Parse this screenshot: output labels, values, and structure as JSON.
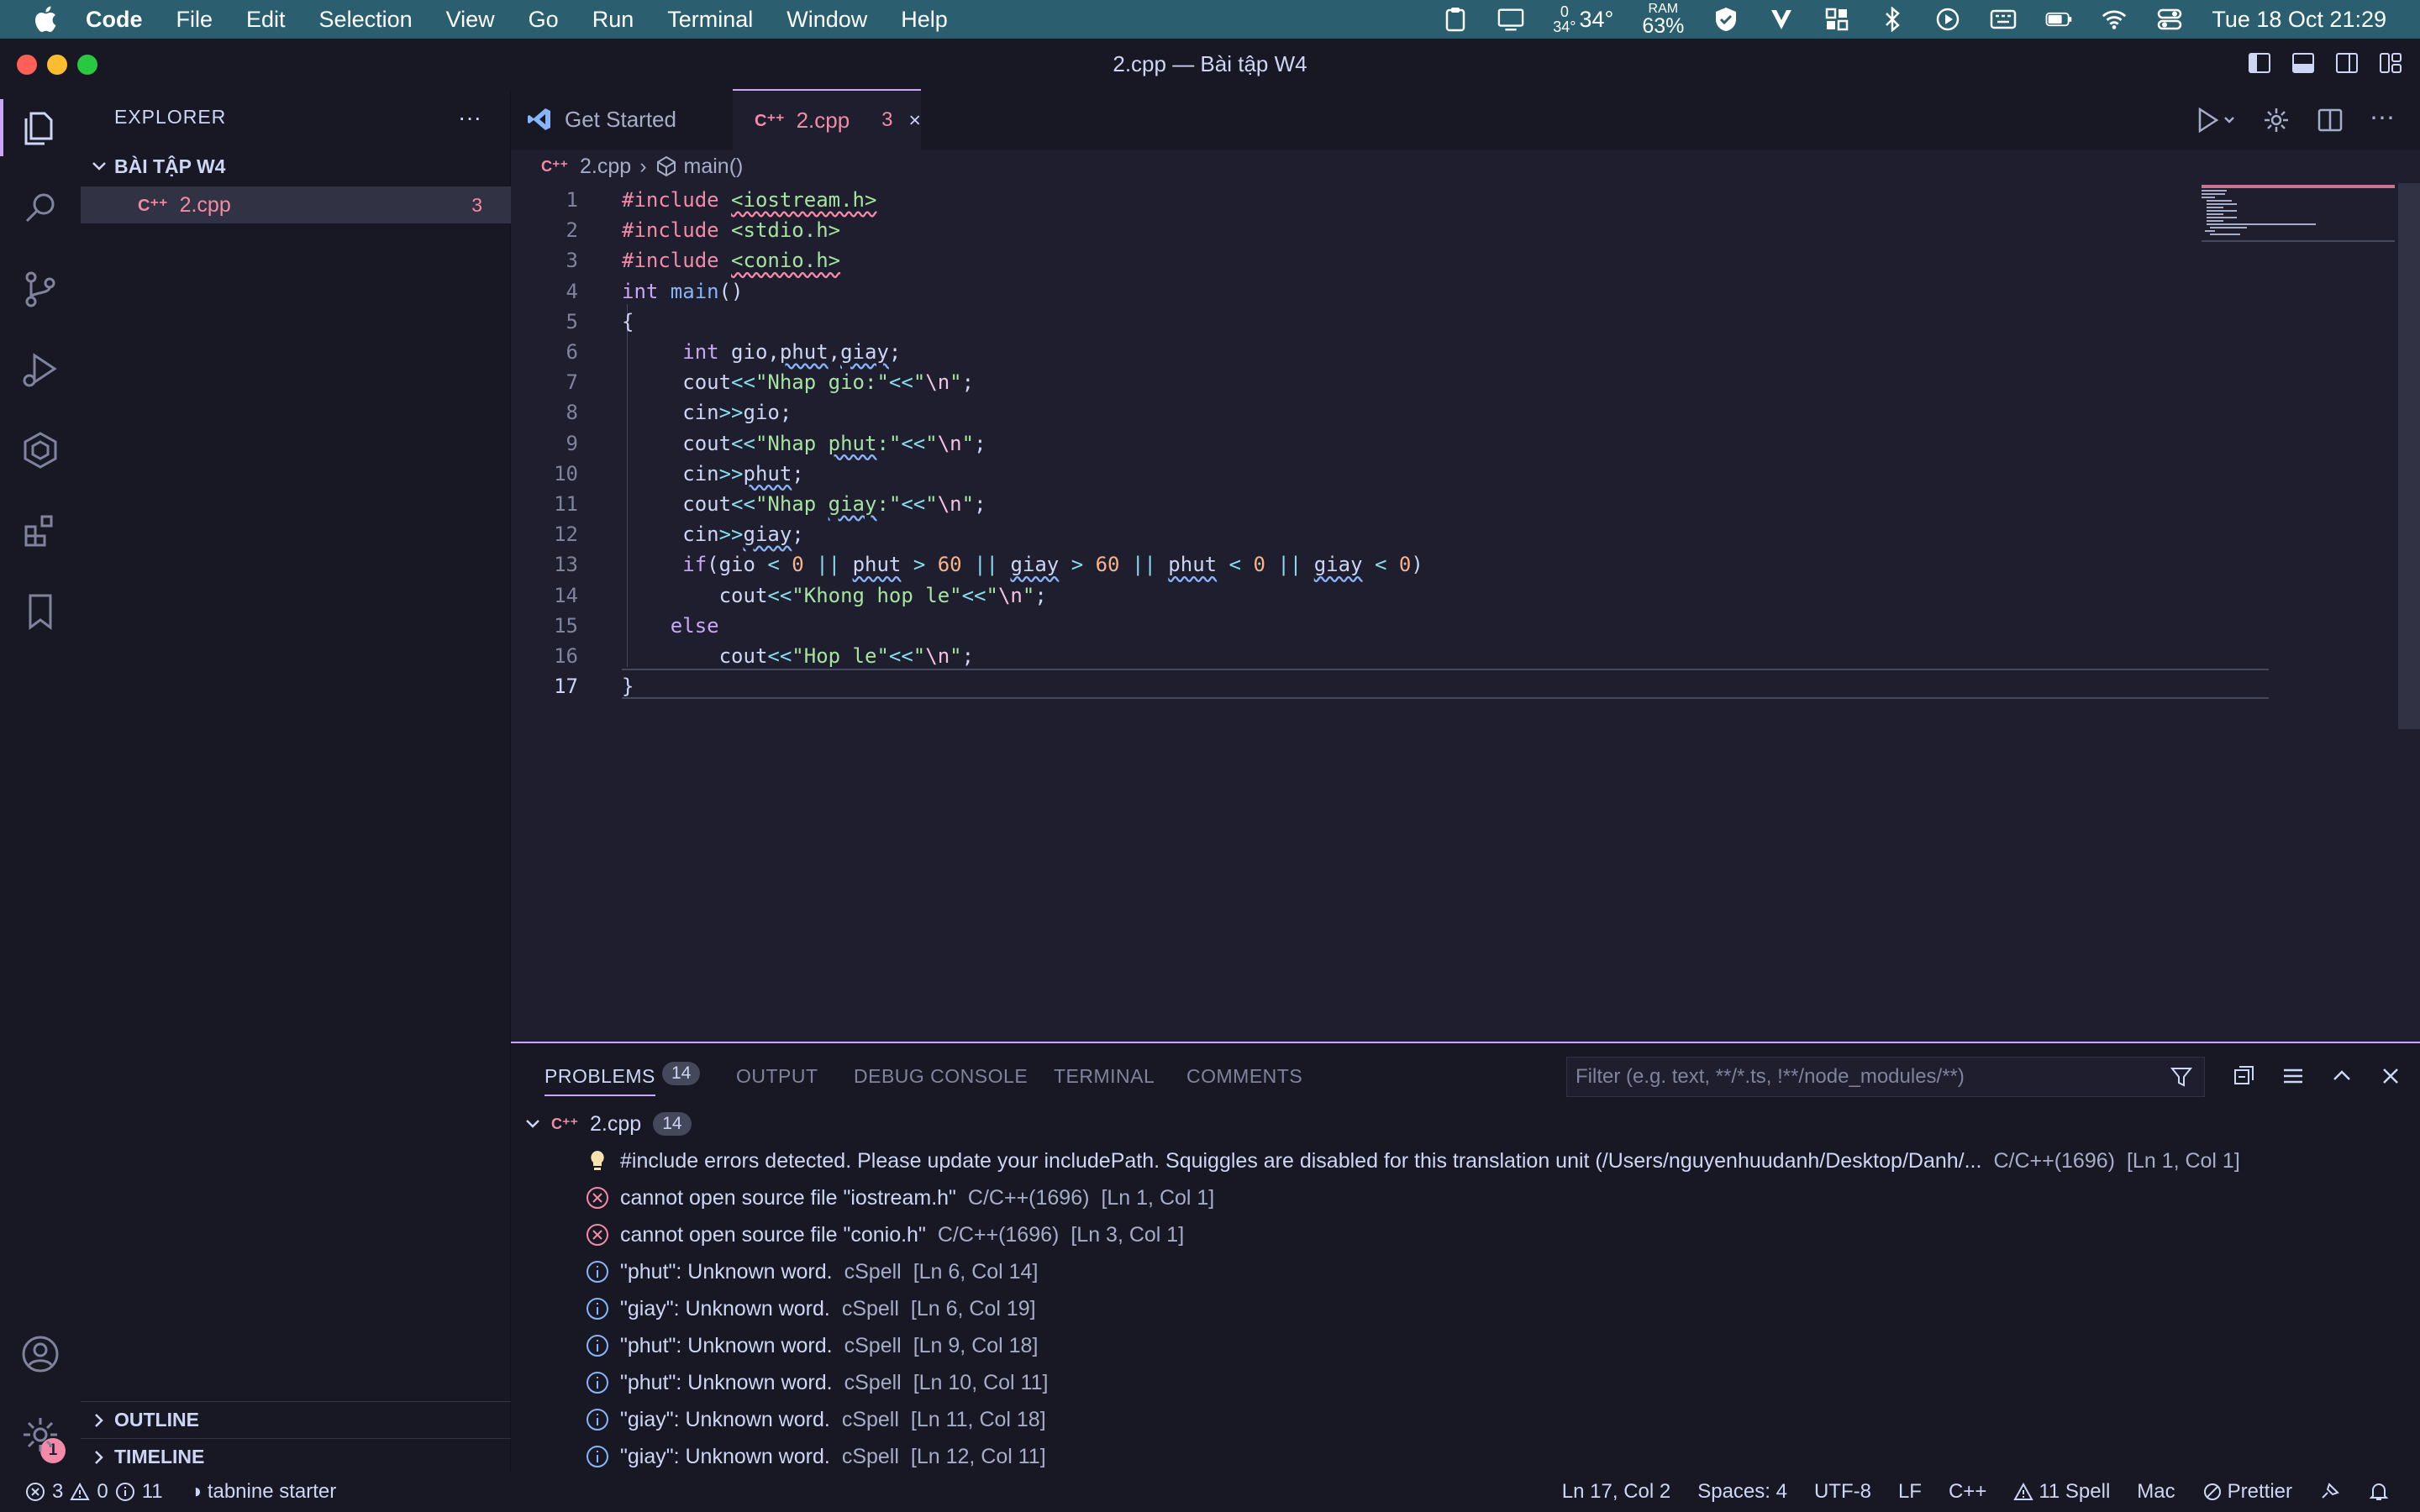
{
  "menubar": {
    "app": "Code",
    "items": [
      "File",
      "Edit",
      "Selection",
      "View",
      "Go",
      "Run",
      "Terminal",
      "Window",
      "Help"
    ],
    "weather_small": "34°",
    "weather_top": "0",
    "weather": "34°",
    "ram_label": "RAM",
    "ram": "63%",
    "datetime": "Tue 18 Oct  21:29"
  },
  "window": {
    "title": "2.cpp — Bài tập W4"
  },
  "sidebar": {
    "header": "EXPLORER",
    "folder": "BÀI TẬP W4",
    "file": {
      "name": "2.cpp",
      "problems": "3"
    },
    "outline": "OUTLINE",
    "timeline": "TIMELINE"
  },
  "activity": {
    "account_badge": "1"
  },
  "tabs": [
    {
      "label": "Get Started"
    },
    {
      "label": "2.cpp",
      "problems": "3"
    }
  ],
  "breadcrumb": {
    "file": "2.cpp",
    "symbol": "main()"
  },
  "code": {
    "lines": [
      [
        [
          "pp",
          "#include "
        ],
        [
          "squig-r str",
          "<iostream.h>"
        ]
      ],
      [
        [
          "pp",
          "#include "
        ],
        [
          "str",
          "<stdio.h>"
        ]
      ],
      [
        [
          "pp",
          "#include "
        ],
        [
          "squig-r str",
          "<conio.h>"
        ]
      ],
      [
        [
          "kw",
          "int "
        ],
        [
          "fn",
          "main"
        ],
        [
          "tx",
          "()"
        ]
      ],
      [
        [
          "tx",
          "{"
        ]
      ],
      [
        [
          "tx",
          "     "
        ],
        [
          "kw",
          "int "
        ],
        [
          "tx",
          "gio,"
        ],
        [
          "squig-b tx",
          "phut"
        ],
        [
          "tx",
          ","
        ],
        [
          "squig-b tx",
          "giay"
        ],
        [
          "tx",
          ";"
        ]
      ],
      [
        [
          "tx",
          "     cout"
        ],
        [
          "op",
          "<<"
        ],
        [
          "str",
          "\"Nhap gio:\""
        ],
        [
          "op",
          "<<"
        ],
        [
          "str",
          "\""
        ],
        [
          "esc",
          "\\n"
        ],
        [
          "str",
          "\""
        ],
        [
          "tx",
          ";"
        ]
      ],
      [
        [
          "tx",
          "     cin"
        ],
        [
          "op",
          ">>"
        ],
        [
          "tx",
          "gio;"
        ]
      ],
      [
        [
          "tx",
          "     cout"
        ],
        [
          "op",
          "<<"
        ],
        [
          "str",
          "\"Nhap "
        ],
        [
          "squig-b str",
          "phut"
        ],
        [
          "str",
          ":\""
        ],
        [
          "op",
          "<<"
        ],
        [
          "str",
          "\""
        ],
        [
          "esc",
          "\\n"
        ],
        [
          "str",
          "\""
        ],
        [
          "tx",
          ";"
        ]
      ],
      [
        [
          "tx",
          "     cin"
        ],
        [
          "op",
          ">>"
        ],
        [
          "squig-b tx",
          "phut"
        ],
        [
          "tx",
          ";"
        ]
      ],
      [
        [
          "tx",
          "     cout"
        ],
        [
          "op",
          "<<"
        ],
        [
          "str",
          "\"Nhap "
        ],
        [
          "squig-b str",
          "giay"
        ],
        [
          "str",
          ":\""
        ],
        [
          "op",
          "<<"
        ],
        [
          "str",
          "\""
        ],
        [
          "esc",
          "\\n"
        ],
        [
          "str",
          "\""
        ],
        [
          "tx",
          ";"
        ]
      ],
      [
        [
          "tx",
          "     cin"
        ],
        [
          "op",
          ">>"
        ],
        [
          "squig-b tx",
          "giay"
        ],
        [
          "tx",
          ";"
        ]
      ],
      [
        [
          "tx",
          "     "
        ],
        [
          "kw",
          "if"
        ],
        [
          "tx",
          "(gio "
        ],
        [
          "op",
          "<"
        ],
        [
          "num",
          " 0 "
        ],
        [
          "op",
          "||"
        ],
        [
          "tx",
          " "
        ],
        [
          "squig-b tx",
          "phut"
        ],
        [
          "tx",
          " "
        ],
        [
          "op",
          ">"
        ],
        [
          "num",
          " 60 "
        ],
        [
          "op",
          "||"
        ],
        [
          "tx",
          " "
        ],
        [
          "squig-b tx",
          "giay"
        ],
        [
          "tx",
          " "
        ],
        [
          "op",
          ">"
        ],
        [
          "num",
          " 60 "
        ],
        [
          "op",
          "||"
        ],
        [
          "tx",
          " "
        ],
        [
          "squig-b tx",
          "phut"
        ],
        [
          "tx",
          " "
        ],
        [
          "op",
          "<"
        ],
        [
          "num",
          " 0 "
        ],
        [
          "op",
          "||"
        ],
        [
          "tx",
          " "
        ],
        [
          "squig-b tx",
          "giay"
        ],
        [
          "tx",
          " "
        ],
        [
          "op",
          "<"
        ],
        [
          "num",
          " 0"
        ],
        [
          "tx",
          ")"
        ]
      ],
      [
        [
          "tx",
          "        cout"
        ],
        [
          "op",
          "<<"
        ],
        [
          "str",
          "\"Khong hop le\""
        ],
        [
          "op",
          "<<"
        ],
        [
          "str",
          "\""
        ],
        [
          "esc",
          "\\n"
        ],
        [
          "str",
          "\""
        ],
        [
          "tx",
          ";"
        ]
      ],
      [
        [
          "tx",
          "    "
        ],
        [
          "kw",
          "else"
        ]
      ],
      [
        [
          "tx",
          "        cout"
        ],
        [
          "op",
          "<<"
        ],
        [
          "str",
          "\"Hop le\""
        ],
        [
          "op",
          "<<"
        ],
        [
          "str",
          "\""
        ],
        [
          "esc",
          "\\n"
        ],
        [
          "str",
          "\""
        ],
        [
          "tx",
          ";"
        ]
      ],
      [
        [
          "tx",
          "}"
        ]
      ]
    ],
    "current_line": 17
  },
  "panel": {
    "tabs": [
      "PROBLEMS",
      "OUTPUT",
      "DEBUG CONSOLE",
      "TERMINAL",
      "COMMENTS"
    ],
    "problems_count": "14",
    "filter_placeholder": "Filter (e.g. text, **/*.ts, !**/node_modules/**)",
    "group": {
      "file": "2.cpp",
      "count": "14"
    },
    "rows": [
      {
        "type": "hint",
        "msg": "#include errors detected. Please update your includePath. Squiggles are disabled for this translation unit (/Users/nguyenhuudanh/Desktop/Danh/...",
        "source": "C/C++(1696)",
        "loc": "[Ln 1, Col 1]"
      },
      {
        "type": "error",
        "msg": "cannot open source file \"iostream.h\"",
        "source": "C/C++(1696)",
        "loc": "[Ln 1, Col 1]"
      },
      {
        "type": "error",
        "msg": "cannot open source file \"conio.h\"",
        "source": "C/C++(1696)",
        "loc": "[Ln 3, Col 1]"
      },
      {
        "type": "info",
        "msg": "\"phut\": Unknown word.",
        "source": "cSpell",
        "loc": "[Ln 6, Col 14]"
      },
      {
        "type": "info",
        "msg": "\"giay\": Unknown word.",
        "source": "cSpell",
        "loc": "[Ln 6, Col 19]"
      },
      {
        "type": "info",
        "msg": "\"phut\": Unknown word.",
        "source": "cSpell",
        "loc": "[Ln 9, Col 18]"
      },
      {
        "type": "info",
        "msg": "\"phut\": Unknown word.",
        "source": "cSpell",
        "loc": "[Ln 10, Col 11]"
      },
      {
        "type": "info",
        "msg": "\"giay\": Unknown word.",
        "source": "cSpell",
        "loc": "[Ln 11, Col 18]"
      },
      {
        "type": "info",
        "msg": "\"giay\": Unknown word.",
        "source": "cSpell",
        "loc": "[Ln 12, Col 11]"
      }
    ]
  },
  "statusbar": {
    "errors": "3",
    "warnings": "0",
    "infos": "11",
    "tabnine": "tabnine starter",
    "position": "Ln 17, Col 2",
    "spaces": "Spaces: 4",
    "encoding": "UTF-8",
    "eol": "LF",
    "language": "C++",
    "spell": "11 Spell",
    "platform": "Mac",
    "formatter": "Prettier"
  },
  "colors": {
    "accent": "#cba6f7",
    "error": "#f38ba8",
    "info": "#89b4fa",
    "string": "#a6e3a1",
    "hint": "#f9e2af"
  }
}
